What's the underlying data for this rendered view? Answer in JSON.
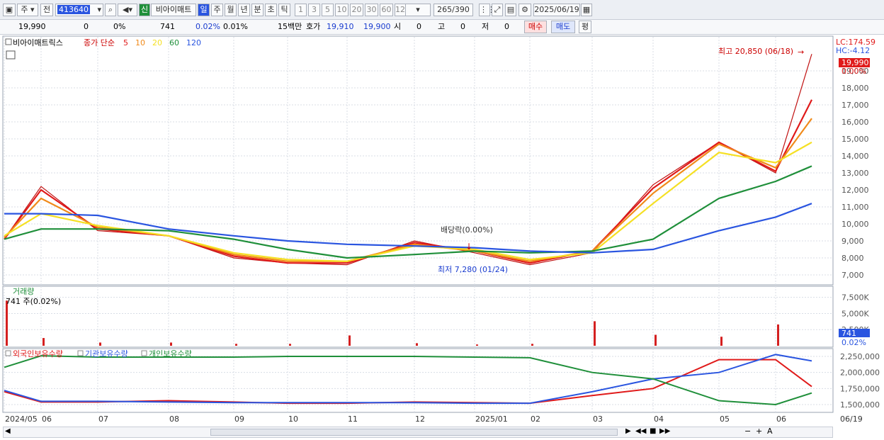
{
  "toolbar": {
    "market": "주",
    "prev": "전",
    "code": "413640",
    "new_badge": "신",
    "name": "비아이매트",
    "periods": [
      "일",
      "주",
      "월",
      "년",
      "분",
      "초",
      "틱"
    ],
    "intervals": [
      "1",
      "3",
      "5",
      "10",
      "20",
      "30",
      "60",
      "120"
    ],
    "count": "265",
    "total": "/390",
    "date": "2025/06/19"
  },
  "infobar": {
    "price": "19,990",
    "change": "0",
    "change_pct": "0%",
    "volume": "741",
    "vol_pct1": "0.02%",
    "vol_pct2": "0.01%",
    "amount": "15백만",
    "quote_label": "호가",
    "ask": "19,910",
    "bid": "19,900",
    "open_label": "시",
    "open": "0",
    "high_label": "고",
    "high": "0",
    "low_label": "저",
    "low": "0",
    "buy": "매수",
    "sell": "매도",
    "avg": "평"
  },
  "main_panel": {
    "stock_title": "비아이매트릭스",
    "ma_label": "종가 단순",
    "ma_periods": [
      "5",
      "10",
      "20",
      "60",
      "120"
    ],
    "ma_colors": [
      "#e01a1a",
      "#f08a1a",
      "#f5e024",
      "#1f8f3a",
      "#2a55e0"
    ],
    "lc": "LC:174.59",
    "hc": "HC:-4.12",
    "high_annotation": "최고 20,850 (06/18)",
    "low_annotation": "최저 7,280 (01/24)",
    "dividend": "배당락(0.00%)",
    "last_price": "19,990",
    "last_pct": "0.00%",
    "y_ticks": [
      "19,000",
      "18,000",
      "17,000",
      "16,000",
      "15,000",
      "14,000",
      "13,000",
      "12,000",
      "11,000",
      "10,000",
      "9,000",
      "8,000",
      "7,000"
    ]
  },
  "volume_panel": {
    "title": "거래량",
    "current": "741 주(0.02%)",
    "y_ticks": [
      "7,500K",
      "5,000K",
      "2,500K"
    ],
    "last_value": "741",
    "last_pct": "0.02%"
  },
  "holding_panel": {
    "series_labels": [
      "외국인보유수량",
      "기관보유수량",
      "개인보유수량"
    ],
    "series_colors": [
      "#e01a1a",
      "#2a55e0",
      "#1f8f3a"
    ],
    "y_ticks": [
      "2,250,000",
      "2,000,000",
      "1,750,000",
      "1,500,000"
    ]
  },
  "x_axis": {
    "labels": [
      "2024/05",
      "06",
      "07",
      "08",
      "09",
      "10",
      "11",
      "12",
      "2025/01",
      "02",
      "03",
      "04",
      "05",
      "06"
    ],
    "end_label": "06/19"
  },
  "chart_data": {
    "type": "line",
    "title": "비아이매트릭스",
    "x": [
      "2024/05",
      "06",
      "07",
      "08",
      "09",
      "10",
      "11",
      "12",
      "2025/01",
      "02",
      "03",
      "04",
      "05",
      "06",
      "06/19"
    ],
    "series": [
      {
        "name": "종가",
        "values": [
          9100,
          12200,
          9600,
          9300,
          8000,
          7700,
          7600,
          9000,
          8300,
          7600,
          8300,
          12300,
          14800,
          13000,
          19990
        ]
      },
      {
        "name": "5",
        "values": [
          9100,
          12000,
          9700,
          9300,
          8100,
          7700,
          7700,
          8900,
          8400,
          7700,
          8400,
          12100,
          14800,
          13100,
          17300
        ]
      },
      {
        "name": "10",
        "values": [
          9200,
          11500,
          9800,
          9300,
          8200,
          7800,
          7800,
          8800,
          8400,
          7800,
          8400,
          11800,
          14700,
          13300,
          16200
        ]
      },
      {
        "name": "20",
        "values": [
          9300,
          10600,
          9900,
          9300,
          8300,
          7900,
          7800,
          8700,
          8500,
          7900,
          8300,
          11200,
          14200,
          13600,
          14800
        ]
      },
      {
        "name": "60",
        "values": [
          9100,
          9700,
          9700,
          9600,
          9100,
          8500,
          8000,
          8200,
          8400,
          8300,
          8400,
          9100,
          11500,
          12500,
          13400
        ]
      },
      {
        "name": "120",
        "values": [
          10600,
          10600,
          10500,
          9700,
          9300,
          9000,
          8800,
          8700,
          8600,
          8400,
          8300,
          8500,
          9600,
          10400,
          11200
        ]
      }
    ],
    "volume": {
      "name": "거래량",
      "x": [
        "2024/05",
        "06",
        "07",
        "08",
        "09",
        "10",
        "11",
        "12",
        "2025/01",
        "02",
        "03",
        "04",
        "05",
        "06"
      ],
      "values": [
        7000,
        1200,
        500,
        500,
        300,
        300,
        1600,
        400,
        200,
        300,
        3800,
        1700,
        1400,
        3300
      ]
    },
    "holdings": [
      {
        "name": "외국인보유수량",
        "values": [
          1700000,
          1540000,
          1540000,
          1560000,
          1540000,
          1520000,
          1520000,
          1540000,
          1530000,
          1520000,
          1640000,
          1750000,
          2200000,
          2200000,
          1780000
        ]
      },
      {
        "name": "기관보유수량",
        "values": [
          1720000,
          1550000,
          1550000,
          1540000,
          1530000,
          1530000,
          1530000,
          1530000,
          1520000,
          1520000,
          1700000,
          1900000,
          2000000,
          2280000,
          2180000
        ]
      },
      {
        "name": "개인보유수량",
        "values": [
          2080000,
          2260000,
          2240000,
          2240000,
          2240000,
          2250000,
          2250000,
          2250000,
          2240000,
          2230000,
          2000000,
          1900000,
          1560000,
          1500000,
          1680000
        ]
      }
    ],
    "ylim": [
      6500,
      21000
    ]
  }
}
